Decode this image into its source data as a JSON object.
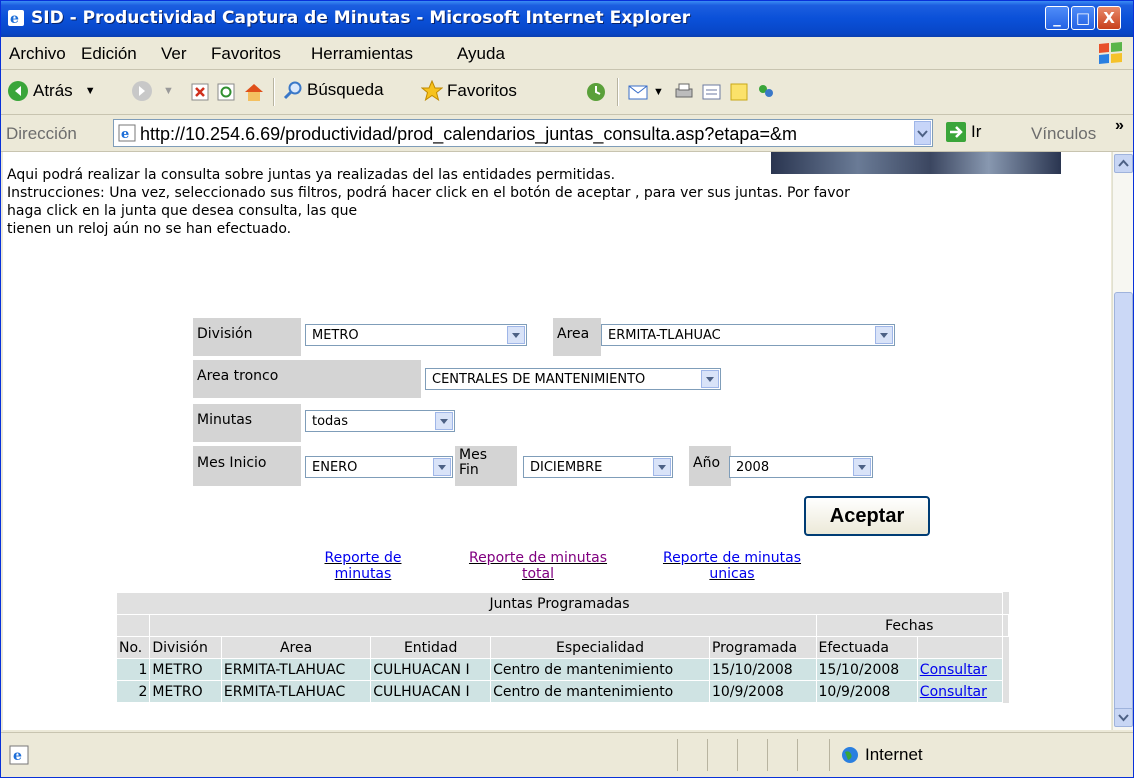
{
  "window": {
    "title": "SID - Productividad Captura de Minutas - Microsoft Internet Explorer",
    "buttons": {
      "minimize": "_",
      "maximize": "□",
      "close": "X"
    }
  },
  "menu": [
    "Archivo",
    "Edición",
    "Ver",
    "Favoritos",
    "Herramientas",
    "Ayuda"
  ],
  "toolbar": {
    "back": "Atrás",
    "search": "Búsqueda",
    "favorites": "Favoritos"
  },
  "address": {
    "label": "Dirección",
    "url": "http://10.254.6.69/productividad/prod_calendarios_juntas_consulta.asp?etapa=&m",
    "go": "Ir",
    "links": "Vínculos"
  },
  "page": {
    "intro_line1": "Aqui podrá realizar la consulta sobre juntas ya realizadas del las entidades permitidas.",
    "intro_line2": "Instrucciones: Una vez, seleccionado sus filtros, podrá hacer click en el botón de aceptar , para ver sus juntas. Por favor",
    "intro_line3": "haga click en la junta que desea consulta, las que",
    "intro_line4": "tienen un reloj aún no se han efectuado.",
    "filters": {
      "division_label": "División",
      "division_value": "METRO",
      "area_label": "Area",
      "area_value": "ERMITA-TLAHUAC",
      "area_tronco_label": "Area tronco",
      "area_tronco_value": "CENTRALES DE MANTENIMIENTO",
      "minutas_label": "Minutas",
      "minutas_value": "todas",
      "mes_inicio_label": "Mes Inicio",
      "mes_inicio_value": "ENERO",
      "mes_fin_label_1": "Mes",
      "mes_fin_label_2": "Fin",
      "mes_fin_value": "DICIEMBRE",
      "anio_label": "Año",
      "anio_value": "2008"
    },
    "accept_button": "Aceptar",
    "report_links": [
      {
        "line1": "Reporte de",
        "line2": "minutas",
        "color": "#0000ee"
      },
      {
        "line1": "Reporte de minutas",
        "line2": "total",
        "color": "#800080"
      },
      {
        "line1": "Reporte de minutas",
        "line2": "unicas",
        "color": "#0000ee"
      }
    ],
    "table": {
      "title": "Juntas Programadas",
      "group_header": "Fechas",
      "headers": [
        "No.",
        "División",
        "Area",
        "Entidad",
        "Especialidad",
        "Programada",
        "Efectuada"
      ],
      "rows": [
        {
          "no": "1",
          "division": "METRO",
          "area": "ERMITA-TLAHUAC",
          "entidad": "CULHUACAN I",
          "especialidad": "Centro de mantenimiento",
          "programada": "15/10/2008",
          "efectuada": "15/10/2008",
          "link": "Consultar"
        },
        {
          "no": "2",
          "division": "METRO",
          "area": "ERMITA-TLAHUAC",
          "entidad": "CULHUACAN I",
          "especialidad": "Centro de mantenimiento",
          "programada": "10/9/2008",
          "efectuada": "10/9/2008",
          "link": "Consultar"
        }
      ]
    }
  },
  "status": {
    "zone": "Internet"
  }
}
